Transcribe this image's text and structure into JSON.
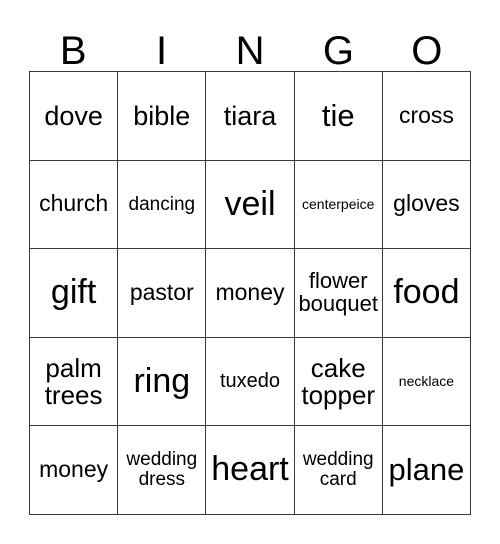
{
  "card": {
    "header_letters": [
      "B",
      "I",
      "N",
      "G",
      "O"
    ],
    "columns": 5,
    "rows": 5,
    "border_color": "#3a3a3a",
    "background_color": "#ffffff",
    "text_color": "#000000",
    "cells": [
      [
        {
          "text": "dove",
          "size": "fs-md"
        },
        {
          "text": "bible",
          "size": "fs-md"
        },
        {
          "text": "tiara",
          "size": "fs-md"
        },
        {
          "text": "tie",
          "size": "fs-lg"
        },
        {
          "text": "cross",
          "size": "fs-sm"
        }
      ],
      [
        {
          "text": "church",
          "size": "fs-sm"
        },
        {
          "text": "dancing",
          "size": "fs-xxs"
        },
        {
          "text": "veil",
          "size": "fs-xl"
        },
        {
          "text": "centerpeice",
          "size": "fs-tiny"
        },
        {
          "text": "gloves",
          "size": "fs-sm"
        }
      ],
      [
        {
          "text": "gift",
          "size": "fs-xl"
        },
        {
          "text": "pastor",
          "size": "fs-sm"
        },
        {
          "text": "money",
          "size": "fs-sm"
        },
        {
          "text": "flower\nbouquet",
          "size": "fs-two-md"
        },
        {
          "text": "food",
          "size": "fs-xl"
        }
      ],
      [
        {
          "text": "palm\ntrees",
          "size": "fs-two-lg"
        },
        {
          "text": "ring",
          "size": "fs-xl"
        },
        {
          "text": "tuxedo",
          "size": "fs-xs"
        },
        {
          "text": "cake\ntopper",
          "size": "fs-two-lg"
        },
        {
          "text": "necklace",
          "size": "fs-tiny"
        }
      ],
      [
        {
          "text": "money",
          "size": "fs-sm"
        },
        {
          "text": "wedding\ndress",
          "size": "fs-two-sm"
        },
        {
          "text": "heart",
          "size": "fs-xl"
        },
        {
          "text": "wedding\ncard",
          "size": "fs-two-sm"
        },
        {
          "text": "plane",
          "size": "fs-lg"
        }
      ]
    ]
  }
}
